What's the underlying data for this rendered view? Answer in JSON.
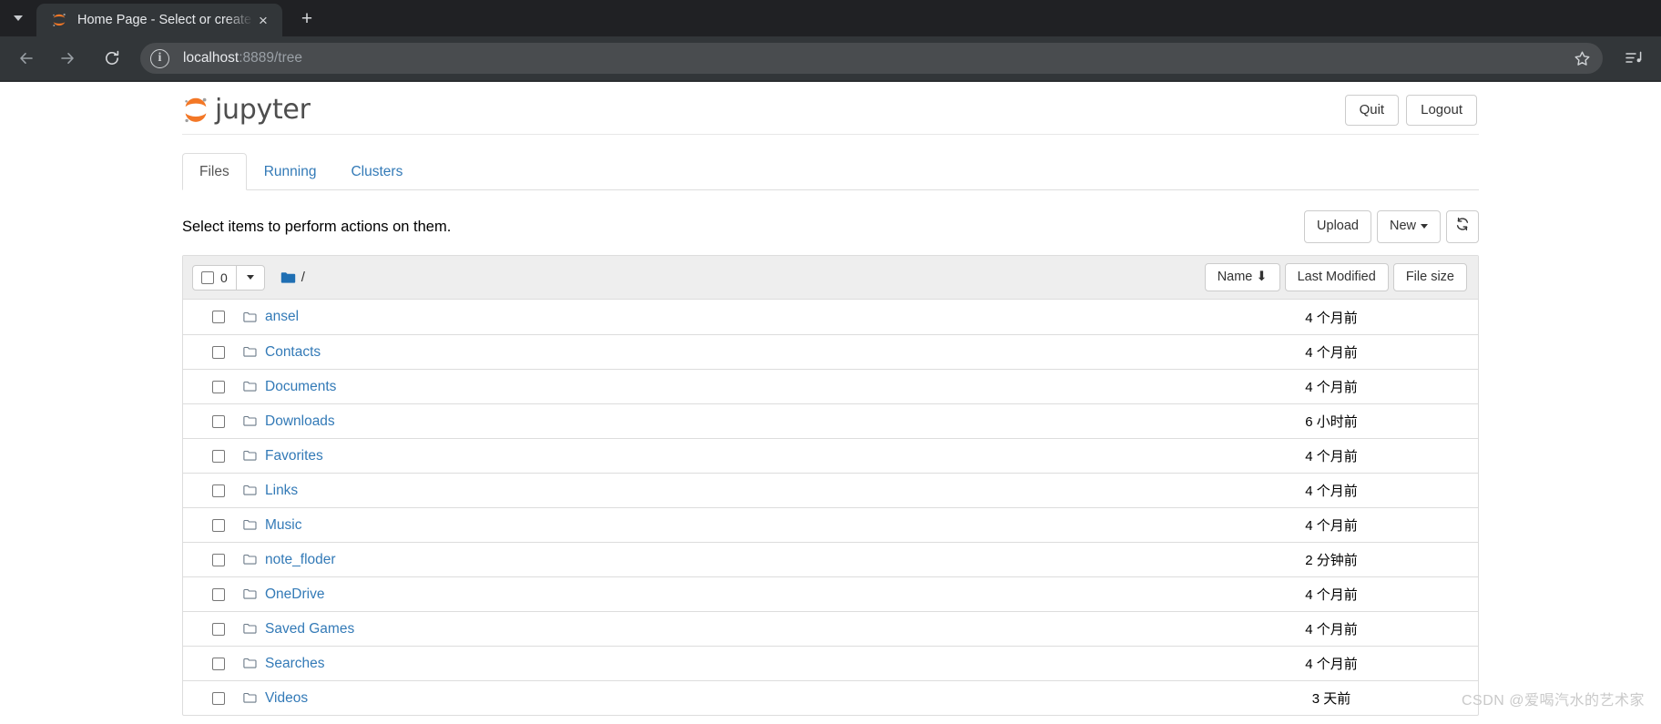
{
  "browser": {
    "tab": {
      "title": "Home Page - Select or create",
      "favicon": "jupyter-favicon",
      "close_label": "×"
    },
    "newtab_label": "+",
    "nav": {
      "back": "back-arrow",
      "forward": "forward-arrow",
      "reload": "reload-icon"
    },
    "omnibox": {
      "info_glyph": "i",
      "host": "localhost",
      "path": ":8889/tree",
      "star": "bookmark-star-icon"
    },
    "right_icons": [
      "media-control-icon"
    ]
  },
  "jupyter": {
    "logo_text": "jupyter",
    "header_buttons": [
      {
        "label": "Quit",
        "name": "quit-button"
      },
      {
        "label": "Logout",
        "name": "logout-button"
      }
    ],
    "tabs": [
      {
        "label": "Files",
        "active": true
      },
      {
        "label": "Running",
        "active": false
      },
      {
        "label": "Clusters",
        "active": false
      }
    ],
    "hint": "Select items to perform actions on them.",
    "actions": {
      "upload": "Upload",
      "new": "New",
      "refresh_icon": "refresh-icon"
    },
    "toolbar": {
      "selected_count": "0",
      "breadcrumb_path": "/",
      "sort_name": "Name",
      "sort_name_arrow": "⬇",
      "sort_last_modified": "Last Modified",
      "sort_file_size": "File size"
    },
    "files": [
      {
        "name": "ansel",
        "type": "folder",
        "modified": "4 个月前",
        "size": ""
      },
      {
        "name": "Contacts",
        "type": "folder",
        "modified": "4 个月前",
        "size": ""
      },
      {
        "name": "Documents",
        "type": "folder",
        "modified": "4 个月前",
        "size": ""
      },
      {
        "name": "Downloads",
        "type": "folder",
        "modified": "6 小时前",
        "size": ""
      },
      {
        "name": "Favorites",
        "type": "folder",
        "modified": "4 个月前",
        "size": ""
      },
      {
        "name": "Links",
        "type": "folder",
        "modified": "4 个月前",
        "size": ""
      },
      {
        "name": "Music",
        "type": "folder",
        "modified": "4 个月前",
        "size": ""
      },
      {
        "name": "note_floder",
        "type": "folder",
        "modified": "2 分钟前",
        "size": ""
      },
      {
        "name": "OneDrive",
        "type": "folder",
        "modified": "4 个月前",
        "size": ""
      },
      {
        "name": "Saved Games",
        "type": "folder",
        "modified": "4 个月前",
        "size": ""
      },
      {
        "name": "Searches",
        "type": "folder",
        "modified": "4 个月前",
        "size": ""
      },
      {
        "name": "Videos",
        "type": "folder",
        "modified": "3 天前",
        "size": ""
      }
    ]
  },
  "watermark": "CSDN @爱喝汽水的艺术家",
  "colors": {
    "chrome_toolbar": "#323639",
    "tabstrip": "#202124",
    "link_blue": "#337ab7",
    "jupyter_orange": "#f37726",
    "folder_blue": "#1f6fb3"
  }
}
